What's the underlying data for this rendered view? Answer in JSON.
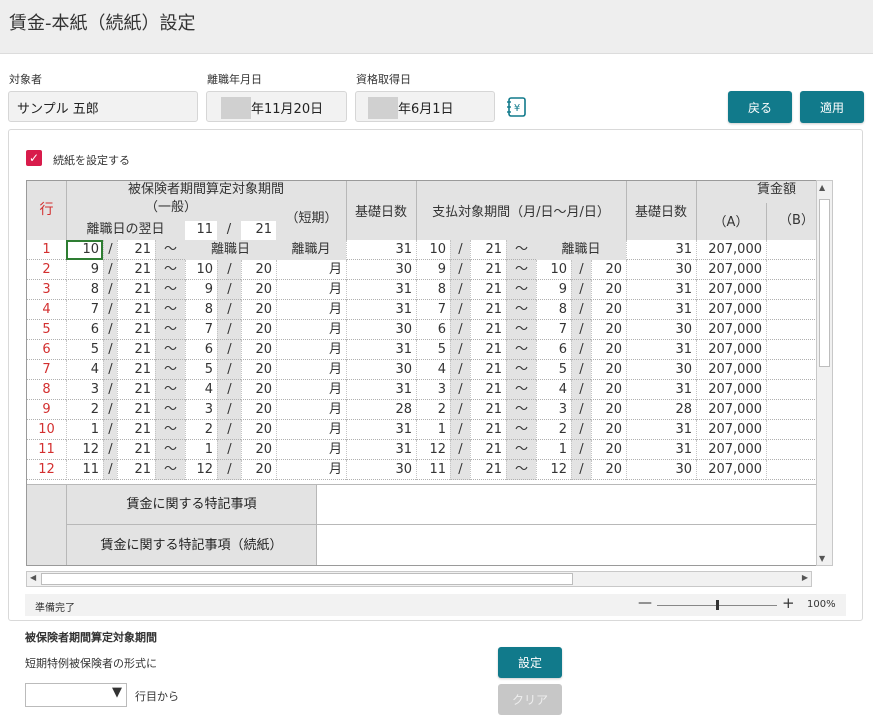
{
  "window": {
    "title": "賃金-本紙（続紙）設定"
  },
  "fields": {
    "subject_label": "対象者",
    "subject_value": "サンプル 五郎",
    "leave_date_label": "離職年月日",
    "leave_date_value": "年11月20日",
    "qualify_date_label": "資格取得日",
    "qualify_date_value": "年6月1日",
    "calendar_icon": "yen-calendar-icon"
  },
  "buttons": {
    "back": "戻る",
    "apply": "適用",
    "set": "設定",
    "clear": "クリア"
  },
  "checkbox": {
    "label": "続紙を設定する",
    "checked": true
  },
  "grid": {
    "headers": {
      "row": "行",
      "period_title": "被保険者期間算定対象期間",
      "general": "（一般）",
      "next_day": "離職日の翌日",
      "next_day_month": "11",
      "slash": "/",
      "next_day_day": "21",
      "short": "（短期）",
      "base_days": "基礎日数",
      "pay_period": "支払対象期間（月/日～月/日）",
      "wage": "賃金額",
      "col_a": "（A）",
      "col_b": "（B）"
    },
    "first_row": {
      "label": "離職日",
      "short": "離職月",
      "pay_label": "離職日"
    },
    "tilde": "～",
    "month_char": "月",
    "rows": [
      {
        "no": "1",
        "m1": "10",
        "d1": "21",
        "m2": "",
        "d2": "",
        "days": "31",
        "pm1": "10",
        "pd1": "21",
        "pm2": "",
        "pd2": "",
        "pdays": "31",
        "wa": "207,000"
      },
      {
        "no": "2",
        "m1": "9",
        "d1": "21",
        "m2": "10",
        "d2": "20",
        "days": "30",
        "pm1": "9",
        "pd1": "21",
        "pm2": "10",
        "pd2": "20",
        "pdays": "30",
        "wa": "207,000"
      },
      {
        "no": "3",
        "m1": "8",
        "d1": "21",
        "m2": "9",
        "d2": "20",
        "days": "31",
        "pm1": "8",
        "pd1": "21",
        "pm2": "9",
        "pd2": "20",
        "pdays": "31",
        "wa": "207,000"
      },
      {
        "no": "4",
        "m1": "7",
        "d1": "21",
        "m2": "8",
        "d2": "20",
        "days": "31",
        "pm1": "7",
        "pd1": "21",
        "pm2": "8",
        "pd2": "20",
        "pdays": "31",
        "wa": "207,000"
      },
      {
        "no": "5",
        "m1": "6",
        "d1": "21",
        "m2": "7",
        "d2": "20",
        "days": "30",
        "pm1": "6",
        "pd1": "21",
        "pm2": "7",
        "pd2": "20",
        "pdays": "30",
        "wa": "207,000"
      },
      {
        "no": "6",
        "m1": "5",
        "d1": "21",
        "m2": "6",
        "d2": "20",
        "days": "31",
        "pm1": "5",
        "pd1": "21",
        "pm2": "6",
        "pd2": "20",
        "pdays": "31",
        "wa": "207,000"
      },
      {
        "no": "7",
        "m1": "4",
        "d1": "21",
        "m2": "5",
        "d2": "20",
        "days": "30",
        "pm1": "4",
        "pd1": "21",
        "pm2": "5",
        "pd2": "20",
        "pdays": "30",
        "wa": "207,000"
      },
      {
        "no": "8",
        "m1": "3",
        "d1": "21",
        "m2": "4",
        "d2": "20",
        "days": "31",
        "pm1": "3",
        "pd1": "21",
        "pm2": "4",
        "pd2": "20",
        "pdays": "31",
        "wa": "207,000"
      },
      {
        "no": "9",
        "m1": "2",
        "d1": "21",
        "m2": "3",
        "d2": "20",
        "days": "28",
        "pm1": "2",
        "pd1": "21",
        "pm2": "3",
        "pd2": "20",
        "pdays": "28",
        "wa": "207,000"
      },
      {
        "no": "10",
        "m1": "1",
        "d1": "21",
        "m2": "2",
        "d2": "20",
        "days": "31",
        "pm1": "1",
        "pd1": "21",
        "pm2": "2",
        "pd2": "20",
        "pdays": "31",
        "wa": "207,000"
      },
      {
        "no": "11",
        "m1": "12",
        "d1": "21",
        "m2": "1",
        "d2": "20",
        "days": "31",
        "pm1": "12",
        "pd1": "21",
        "pm2": "1",
        "pd2": "20",
        "pdays": "31",
        "wa": "207,000"
      },
      {
        "no": "12",
        "m1": "11",
        "d1": "21",
        "m2": "12",
        "d2": "20",
        "days": "30",
        "pm1": "11",
        "pd1": "21",
        "pm2": "12",
        "pd2": "20",
        "pdays": "30",
        "wa": "207,000"
      }
    ],
    "note1_label": "賃金に関する特記事項",
    "note2_label": "賃金に関する特記事項（続紙）"
  },
  "status": {
    "text": "準備完了",
    "zoom_minus": "—",
    "zoom_plus": "+",
    "zoom": "100%",
    "zoom_level_percent": 100
  },
  "section": {
    "title": "被保険者期間算定対象期間",
    "subtitle": "短期特例被保険者の形式に",
    "from_row": "行目から"
  },
  "colors": {
    "accent": "#117a8b",
    "checkbox": "#d81b4b",
    "row_number": "#d32f2f",
    "header_bg": "#e3e3e3"
  }
}
